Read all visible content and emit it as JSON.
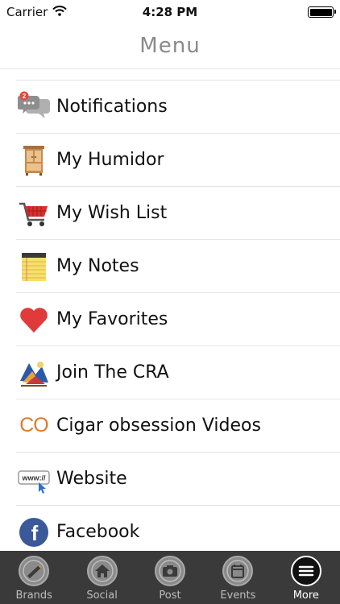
{
  "status_bar": {
    "carrier": "Carrier",
    "time": "4:28 PM"
  },
  "header": {
    "title": "Menu"
  },
  "menu": {
    "items": [
      {
        "label": "Notifications",
        "icon": "chat-bubbles-icon",
        "badge": "2"
      },
      {
        "label": "My Humidor",
        "icon": "cabinet-icon"
      },
      {
        "label": "My Wish List",
        "icon": "shopping-cart-icon"
      },
      {
        "label": "My Notes",
        "icon": "notepad-icon"
      },
      {
        "label": "My Favorites",
        "icon": "heart-icon"
      },
      {
        "label": "Join The CRA",
        "icon": "cra-logo-icon"
      },
      {
        "label": "Cigar obsession Videos",
        "icon": "co-logo-icon",
        "icon_text": "CO"
      },
      {
        "label": "Website",
        "icon": "www-icon",
        "icon_text": "www://"
      },
      {
        "label": "Facebook",
        "icon": "facebook-icon",
        "icon_text": "f"
      }
    ]
  },
  "tab_bar": {
    "tabs": [
      {
        "label": "Brands",
        "icon": "cigar-icon"
      },
      {
        "label": "Social",
        "icon": "home-icon"
      },
      {
        "label": "Post",
        "icon": "camera-icon"
      },
      {
        "label": "Events",
        "icon": "calendar-icon"
      },
      {
        "label": "More",
        "icon": "menu-lines-icon",
        "active": true
      }
    ]
  },
  "colors": {
    "tab_bar_bg": "#3a3a3a",
    "header_title": "#8a8a8a",
    "badge": "#e8463a",
    "co_orange": "#e07a2a",
    "facebook_blue": "#3b5998",
    "heart_red": "#e03a3a"
  }
}
